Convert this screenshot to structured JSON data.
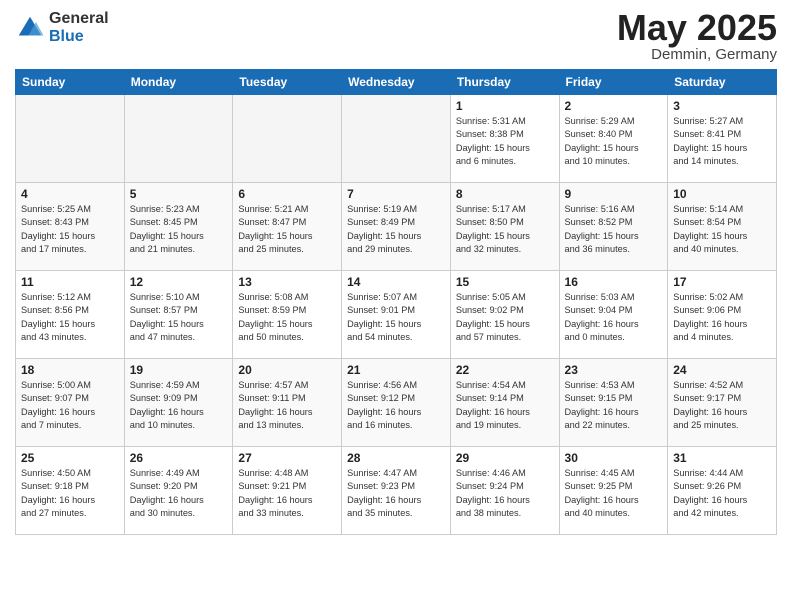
{
  "logo": {
    "general": "General",
    "blue": "Blue"
  },
  "title": {
    "month": "May 2025",
    "location": "Demmin, Germany"
  },
  "weekdays": [
    "Sunday",
    "Monday",
    "Tuesday",
    "Wednesday",
    "Thursday",
    "Friday",
    "Saturday"
  ],
  "weeks": [
    [
      {
        "day": "",
        "detail": ""
      },
      {
        "day": "",
        "detail": ""
      },
      {
        "day": "",
        "detail": ""
      },
      {
        "day": "",
        "detail": ""
      },
      {
        "day": "1",
        "detail": "Sunrise: 5:31 AM\nSunset: 8:38 PM\nDaylight: 15 hours\nand 6 minutes."
      },
      {
        "day": "2",
        "detail": "Sunrise: 5:29 AM\nSunset: 8:40 PM\nDaylight: 15 hours\nand 10 minutes."
      },
      {
        "day": "3",
        "detail": "Sunrise: 5:27 AM\nSunset: 8:41 PM\nDaylight: 15 hours\nand 14 minutes."
      }
    ],
    [
      {
        "day": "4",
        "detail": "Sunrise: 5:25 AM\nSunset: 8:43 PM\nDaylight: 15 hours\nand 17 minutes."
      },
      {
        "day": "5",
        "detail": "Sunrise: 5:23 AM\nSunset: 8:45 PM\nDaylight: 15 hours\nand 21 minutes."
      },
      {
        "day": "6",
        "detail": "Sunrise: 5:21 AM\nSunset: 8:47 PM\nDaylight: 15 hours\nand 25 minutes."
      },
      {
        "day": "7",
        "detail": "Sunrise: 5:19 AM\nSunset: 8:49 PM\nDaylight: 15 hours\nand 29 minutes."
      },
      {
        "day": "8",
        "detail": "Sunrise: 5:17 AM\nSunset: 8:50 PM\nDaylight: 15 hours\nand 32 minutes."
      },
      {
        "day": "9",
        "detail": "Sunrise: 5:16 AM\nSunset: 8:52 PM\nDaylight: 15 hours\nand 36 minutes."
      },
      {
        "day": "10",
        "detail": "Sunrise: 5:14 AM\nSunset: 8:54 PM\nDaylight: 15 hours\nand 40 minutes."
      }
    ],
    [
      {
        "day": "11",
        "detail": "Sunrise: 5:12 AM\nSunset: 8:56 PM\nDaylight: 15 hours\nand 43 minutes."
      },
      {
        "day": "12",
        "detail": "Sunrise: 5:10 AM\nSunset: 8:57 PM\nDaylight: 15 hours\nand 47 minutes."
      },
      {
        "day": "13",
        "detail": "Sunrise: 5:08 AM\nSunset: 8:59 PM\nDaylight: 15 hours\nand 50 minutes."
      },
      {
        "day": "14",
        "detail": "Sunrise: 5:07 AM\nSunset: 9:01 PM\nDaylight: 15 hours\nand 54 minutes."
      },
      {
        "day": "15",
        "detail": "Sunrise: 5:05 AM\nSunset: 9:02 PM\nDaylight: 15 hours\nand 57 minutes."
      },
      {
        "day": "16",
        "detail": "Sunrise: 5:03 AM\nSunset: 9:04 PM\nDaylight: 16 hours\nand 0 minutes."
      },
      {
        "day": "17",
        "detail": "Sunrise: 5:02 AM\nSunset: 9:06 PM\nDaylight: 16 hours\nand 4 minutes."
      }
    ],
    [
      {
        "day": "18",
        "detail": "Sunrise: 5:00 AM\nSunset: 9:07 PM\nDaylight: 16 hours\nand 7 minutes."
      },
      {
        "day": "19",
        "detail": "Sunrise: 4:59 AM\nSunset: 9:09 PM\nDaylight: 16 hours\nand 10 minutes."
      },
      {
        "day": "20",
        "detail": "Sunrise: 4:57 AM\nSunset: 9:11 PM\nDaylight: 16 hours\nand 13 minutes."
      },
      {
        "day": "21",
        "detail": "Sunrise: 4:56 AM\nSunset: 9:12 PM\nDaylight: 16 hours\nand 16 minutes."
      },
      {
        "day": "22",
        "detail": "Sunrise: 4:54 AM\nSunset: 9:14 PM\nDaylight: 16 hours\nand 19 minutes."
      },
      {
        "day": "23",
        "detail": "Sunrise: 4:53 AM\nSunset: 9:15 PM\nDaylight: 16 hours\nand 22 minutes."
      },
      {
        "day": "24",
        "detail": "Sunrise: 4:52 AM\nSunset: 9:17 PM\nDaylight: 16 hours\nand 25 minutes."
      }
    ],
    [
      {
        "day": "25",
        "detail": "Sunrise: 4:50 AM\nSunset: 9:18 PM\nDaylight: 16 hours\nand 27 minutes."
      },
      {
        "day": "26",
        "detail": "Sunrise: 4:49 AM\nSunset: 9:20 PM\nDaylight: 16 hours\nand 30 minutes."
      },
      {
        "day": "27",
        "detail": "Sunrise: 4:48 AM\nSunset: 9:21 PM\nDaylight: 16 hours\nand 33 minutes."
      },
      {
        "day": "28",
        "detail": "Sunrise: 4:47 AM\nSunset: 9:23 PM\nDaylight: 16 hours\nand 35 minutes."
      },
      {
        "day": "29",
        "detail": "Sunrise: 4:46 AM\nSunset: 9:24 PM\nDaylight: 16 hours\nand 38 minutes."
      },
      {
        "day": "30",
        "detail": "Sunrise: 4:45 AM\nSunset: 9:25 PM\nDaylight: 16 hours\nand 40 minutes."
      },
      {
        "day": "31",
        "detail": "Sunrise: 4:44 AM\nSunset: 9:26 PM\nDaylight: 16 hours\nand 42 minutes."
      }
    ]
  ]
}
